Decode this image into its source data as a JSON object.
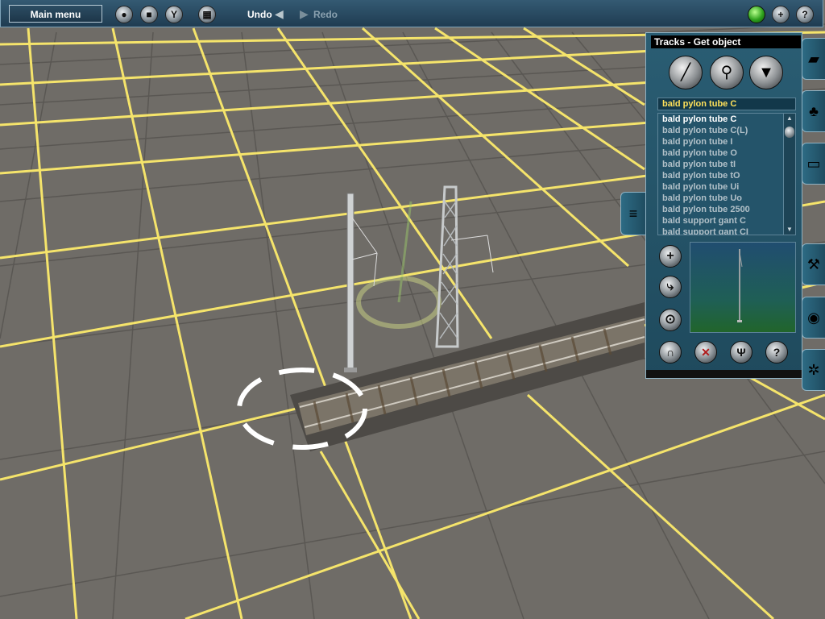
{
  "toolbar": {
    "main_menu": "Main menu",
    "undo": "Undo",
    "redo": "Redo"
  },
  "panel": {
    "title": "Tracks - Get object",
    "search_text": "bald pylon tube C",
    "items": [
      "bald pylon tube C",
      "bald pylon tube C(L)",
      "bald pylon tube I",
      "bald pylon tube O",
      "bald pylon tube tI",
      "bald pylon tube tO",
      "bald pylon tube Ui",
      "bald pylon tube Uo",
      "bald pylon tube 2500",
      "bald support gant C",
      "bald support gant CI"
    ],
    "selected_index": 0
  },
  "icons": {
    "toolbar": [
      "camera-icon",
      "stop-icon",
      "filter-icon",
      "grid-icon",
      "undo-arrow-icon",
      "redo-arrow-icon",
      "status-led-icon",
      "add-icon",
      "help-icon"
    ],
    "mode_buttons": [
      "track-tool-icon",
      "get-object-icon",
      "dropper-icon"
    ],
    "side_tools": [
      "add-icon",
      "smooth-icon",
      "link-icon"
    ],
    "bottom_tools": [
      "magnet-icon",
      "delete-icon",
      "trident-icon",
      "help-icon"
    ],
    "tabs": [
      "terrain-tab-icon",
      "trees-tab-icon",
      "buildings-tab-icon",
      "tools-tab-icon",
      "world-tab-icon",
      "settings-tab-icon"
    ]
  },
  "colors": {
    "grid_line": "#f5e46b",
    "panel_bg": "#245468",
    "selected_text": "#ffffff",
    "search_text": "#ffe15a"
  }
}
